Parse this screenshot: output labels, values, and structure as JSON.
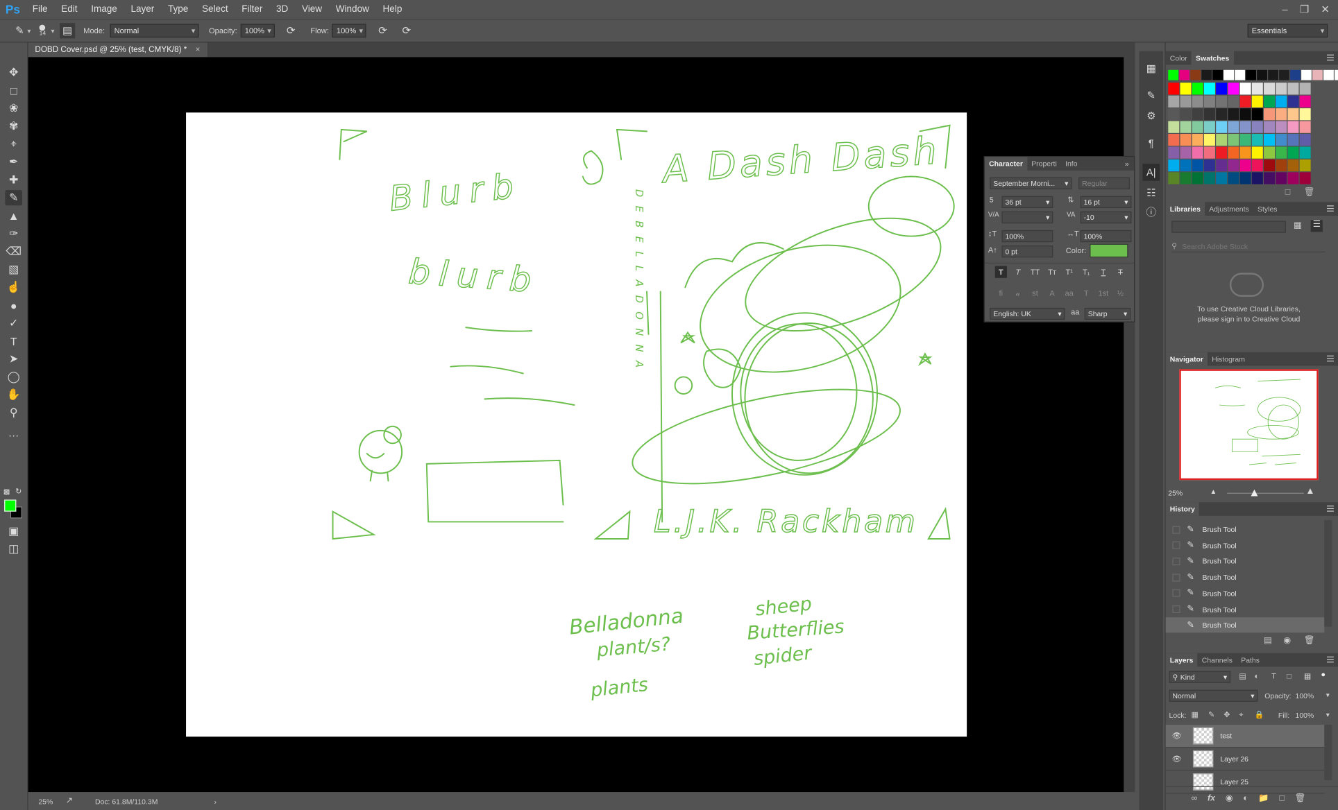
{
  "app": {
    "logo": "Ps"
  },
  "menu": [
    "File",
    "Edit",
    "Image",
    "Layer",
    "Type",
    "Select",
    "Filter",
    "3D",
    "View",
    "Window",
    "Help"
  ],
  "options": {
    "brush_size": "14",
    "mode_label": "Mode:",
    "mode_value": "Normal",
    "opacity_label": "Opacity:",
    "opacity_value": "100%",
    "flow_label": "Flow:",
    "flow_value": "100%",
    "workspace": "Essentials"
  },
  "document": {
    "tab_title": "DOBD Cover.psd @ 25% (test, CMYK/8) *",
    "close": "×"
  },
  "status": {
    "zoom": "25%",
    "doc": "Doc: 61.8M/110.3M"
  },
  "character": {
    "tabs": [
      "Character",
      "Properti",
      "Info"
    ],
    "font_family": "September Morni...",
    "font_style": "Regular",
    "size": "36 pt",
    "leading": "16 pt",
    "tracking": "-10",
    "vscale": "100%",
    "hscale": "100%",
    "baseline": "0 pt",
    "color_label": "Color:",
    "language": "English: UK",
    "antialias": "Sharp",
    "aa_label": "aa"
  },
  "swatches": {
    "tabs": [
      "Color",
      "Swatches"
    ]
  },
  "libraries": {
    "tabs": [
      "Libraries",
      "Adjustments",
      "Styles"
    ],
    "search_placeholder": "Search Adobe Stock",
    "msg1": "To use Creative Cloud Libraries,",
    "msg2": "please sign in to Creative Cloud"
  },
  "navigator": {
    "tabs": [
      "Navigator",
      "Histogram"
    ],
    "zoom": "25%"
  },
  "history": {
    "title": "History",
    "items": [
      "Brush Tool",
      "Brush Tool",
      "Brush Tool",
      "Brush Tool",
      "Brush Tool",
      "Brush Tool",
      "Brush Tool"
    ]
  },
  "layers": {
    "tabs": [
      "Layers",
      "Channels",
      "Paths"
    ],
    "kind": "Kind",
    "blend": "Normal",
    "opacity_label": "Opacity:",
    "opacity_value": "100%",
    "lock_label": "Lock:",
    "fill_label": "Fill:",
    "fill_value": "100%",
    "items": [
      {
        "name": "test"
      },
      {
        "name": "Layer 26"
      },
      {
        "name": "Layer 25"
      }
    ]
  },
  "sketch_text": {
    "blurb1": "Blurb",
    "blurb2": "blurb",
    "title": "A Dash Dash",
    "author": "L.J.K. Rackham",
    "note1": "Belladonna",
    "note2": "plant/s?",
    "note3": "plants",
    "note4": "sheep",
    "note5": "Butterflies",
    "note6": "spider",
    "spine": "DEBELLADONNA"
  },
  "colors": {
    "accent_green": "#6cbf4d",
    "foreground": "#00ff00",
    "background": "#000000",
    "char_color": "#6cbf4d"
  }
}
